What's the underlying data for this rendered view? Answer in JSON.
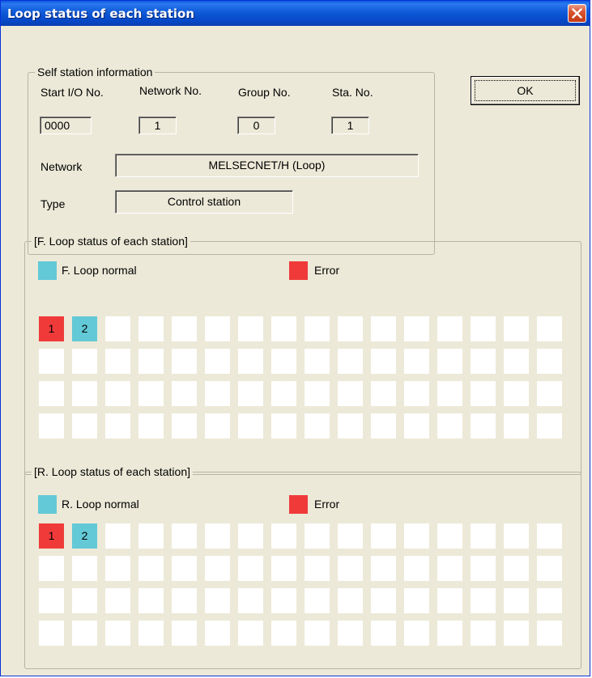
{
  "window": {
    "title": "Loop status of each station"
  },
  "ok_label": "OK",
  "self_station": {
    "legend": "Self station information",
    "start_io_label": "Start I/O No.",
    "network_no_label": "Network No.",
    "group_no_label": "Group No.",
    "sta_no_label": "Sta. No.",
    "start_io_value": "0000",
    "network_no_value": "1",
    "group_no_value": "0",
    "sta_no_value": "1",
    "network_label": "Network",
    "network_value": "MELSECNET/H (Loop)",
    "type_label": "Type",
    "type_value": "Control station"
  },
  "f_loop": {
    "legend": "[F. Loop status of each station]",
    "normal_label": "F. Loop normal",
    "error_label": "Error",
    "stations": [
      {
        "label": "1",
        "status": "error"
      },
      {
        "label": "2",
        "status": "normal"
      }
    ]
  },
  "r_loop": {
    "legend": "[R. Loop status of each station]",
    "normal_label": "R. Loop normal",
    "error_label": "Error",
    "stations": [
      {
        "label": "1",
        "status": "error"
      },
      {
        "label": "2",
        "status": "normal"
      }
    ]
  },
  "colors": {
    "normal": "#63c9d6",
    "error": "#f03a3a",
    "empty": "#ffffff"
  }
}
